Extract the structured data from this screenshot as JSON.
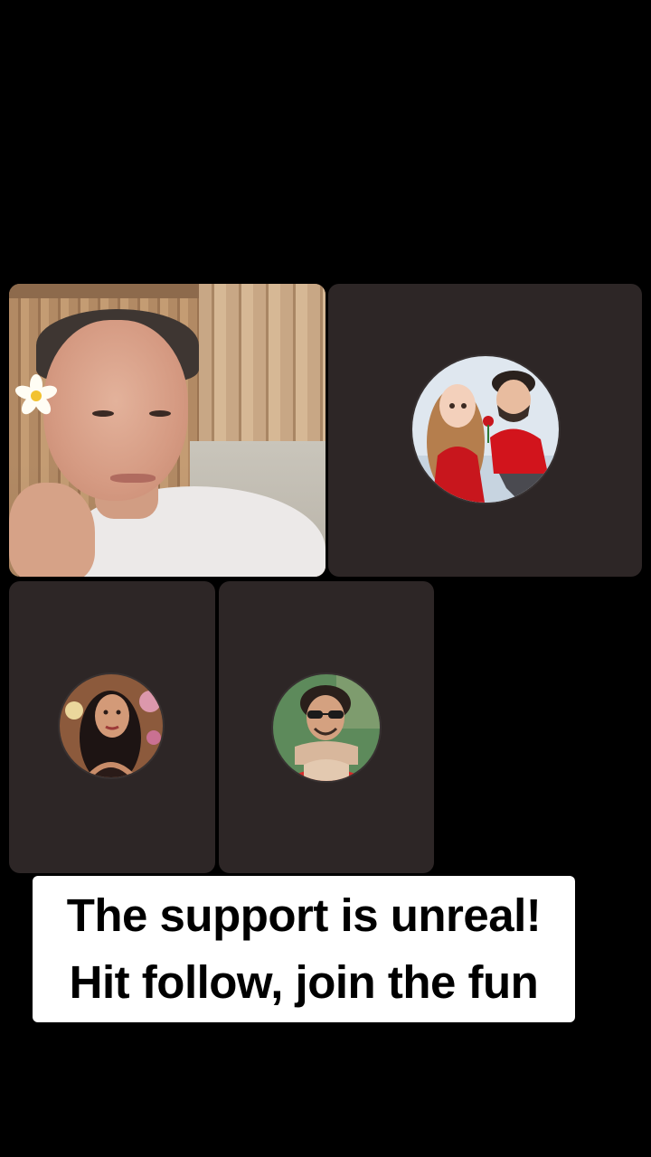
{
  "caption": {
    "line1": "The support is unreal!",
    "line2": "Hit follow, join the fun"
  },
  "participants": [
    {
      "type": "live-video",
      "icon": "person-selfie-video"
    },
    {
      "type": "avatar",
      "icon": "couple-cartoon-avatar"
    },
    {
      "type": "avatar",
      "icon": "woman-avatar"
    },
    {
      "type": "avatar",
      "icon": "man-sunglasses-avatar"
    }
  ],
  "colors": {
    "background": "#000000",
    "tile": "#2d2626",
    "caption_bg": "#ffffff",
    "caption_text": "#000000"
  }
}
